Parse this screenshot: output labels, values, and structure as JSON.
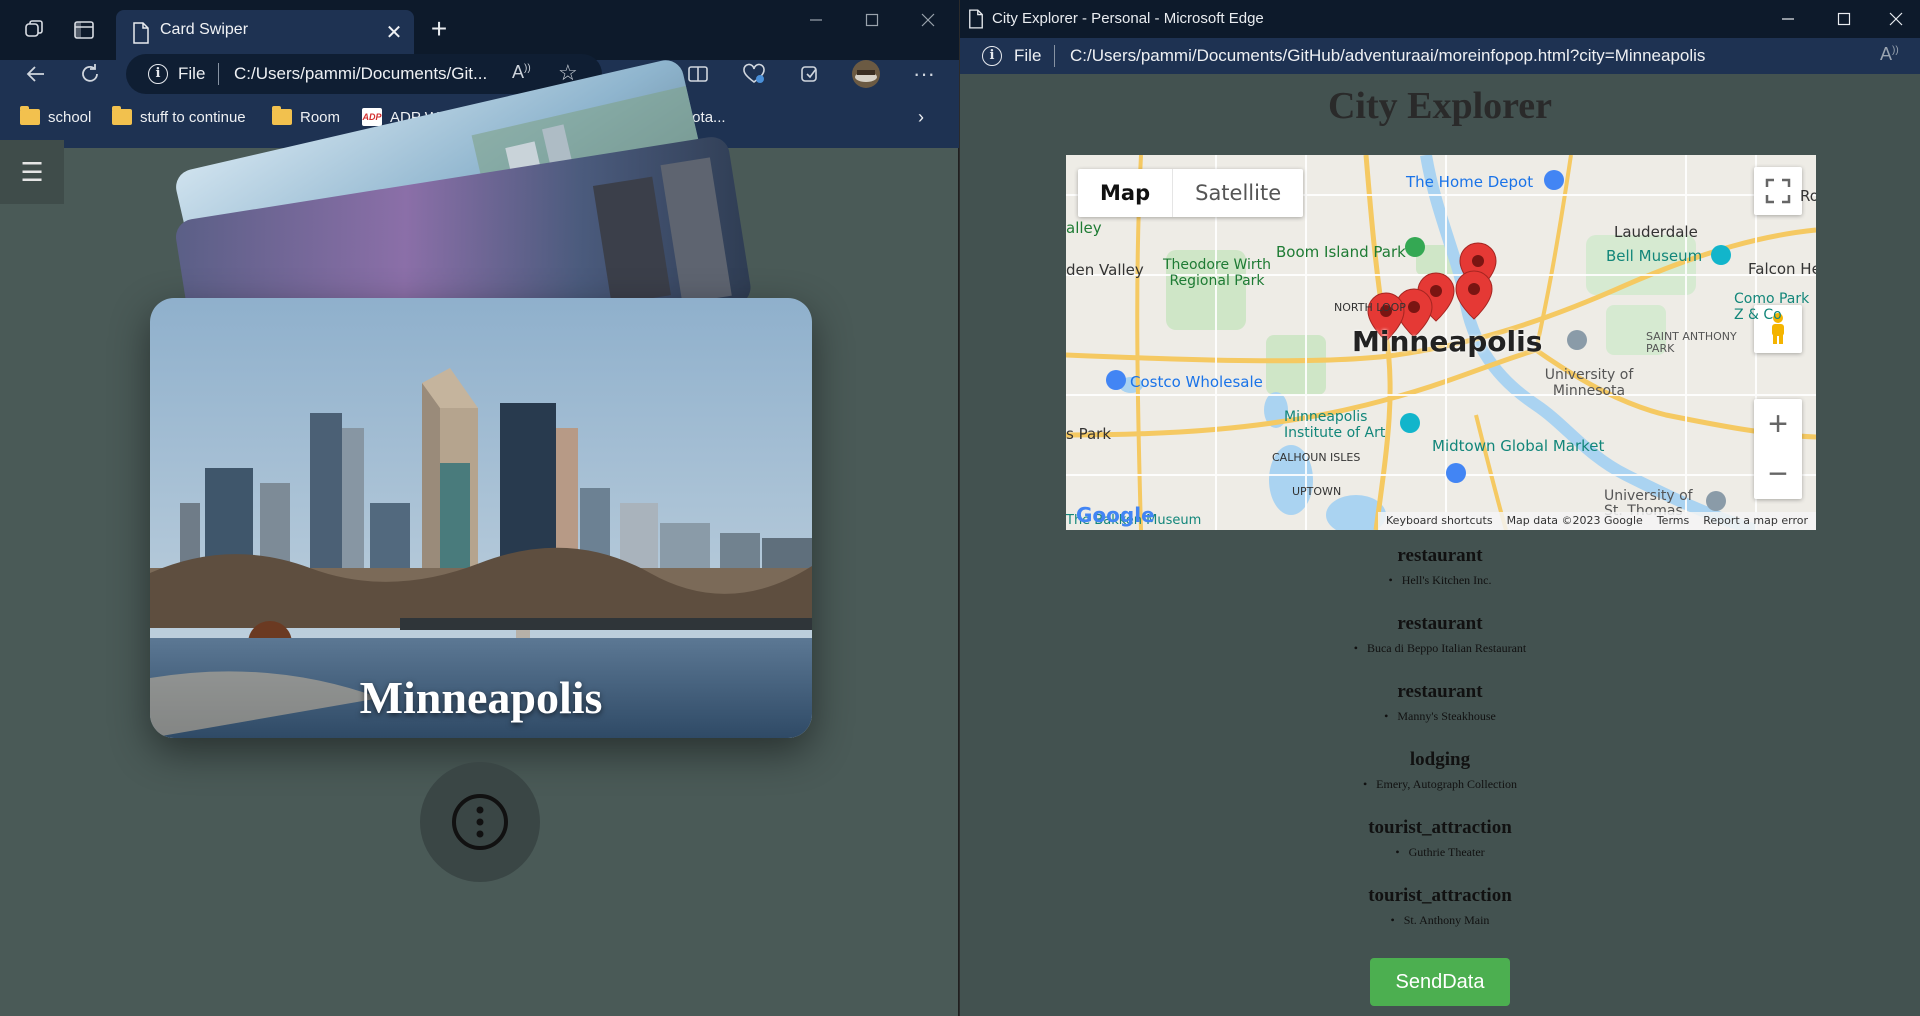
{
  "left_browser": {
    "tab_title": "Card Swiper",
    "address": {
      "scheme_label": "File",
      "url": "C:/Users/pammi/Documents/Git..."
    },
    "bookmarks": [
      {
        "label": "school",
        "icon": "folder-icon"
      },
      {
        "label": "stuff to continue",
        "icon": "folder-icon"
      },
      {
        "label": "Room",
        "icon": "folder-icon"
      },
      {
        "label": "ADP Workforce Now",
        "icon": "adp-icon"
      },
      {
        "label": "GSCCCA.org - Nota...",
        "icon": "gsccca-icon"
      }
    ]
  },
  "card_swiper": {
    "menu_icon": "☰",
    "card_city": "Minneapolis"
  },
  "right_browser": {
    "window_title": "City Explorer - Personal - Microsoft Edge",
    "address": {
      "scheme_label": "File",
      "url": "C:/Users/pammi/Documents/GitHub/adventuraai/moreinfopop.html?city=Minneapolis"
    }
  },
  "city_explorer": {
    "heading": "City Explorer",
    "map": {
      "type_buttons": [
        "Map",
        "Satellite"
      ],
      "city_label": "Minneapolis",
      "labels": [
        "The Home Depot",
        "Lauderdale",
        "Bell Museum",
        "Falcon He",
        "Boom Island Park",
        "Theodore Wirth Regional Park",
        "Como Park Z & Co",
        "NORTH LOOP",
        "SAINT ANTHONY PARK",
        "University of Minnesota",
        "Costco Wholesale",
        "Minneapolis Institute of Art",
        "Midtown Global Market",
        "CALHOUN ISLES",
        "UPTOWN",
        "s Park",
        "den Valley",
        "alley",
        "Ro",
        "University of St. Thomas",
        "The Bakken Museum"
      ],
      "footer": [
        "Keyboard shortcuts",
        "Map data ©2023 Google",
        "Terms",
        "Report a map error"
      ],
      "logo": "Google"
    },
    "places": [
      {
        "type": "restaurant",
        "name": "Hell's Kitchen Inc."
      },
      {
        "type": "restaurant",
        "name": "Buca di Beppo Italian Restaurant"
      },
      {
        "type": "restaurant",
        "name": "Manny's Steakhouse"
      },
      {
        "type": "lodging",
        "name": "Emery, Autograph Collection"
      },
      {
        "type": "tourist_attraction",
        "name": "Guthrie Theater"
      },
      {
        "type": "tourist_attraction",
        "name": "St. Anthony Main"
      }
    ],
    "send_button": "SendData"
  }
}
